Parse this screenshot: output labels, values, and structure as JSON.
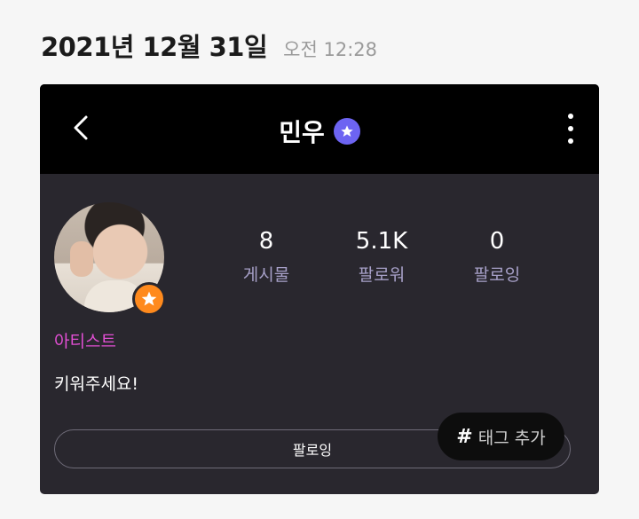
{
  "header": {
    "date": "2021년 12월 31일",
    "time": "오전 12:28"
  },
  "profile": {
    "name": "민우",
    "role": "아티스트",
    "bio": "키워주세요!",
    "stats": [
      {
        "value": "8",
        "label": "게시물"
      },
      {
        "value": "5.1K",
        "label": "팔로워"
      },
      {
        "value": "0",
        "label": "팔로잉"
      }
    ],
    "follow_button": "팔로잉",
    "tag_button": {
      "hash": "#",
      "label": "태그 추가"
    }
  },
  "icons": [
    "back-chevron-icon",
    "verified-star-icon",
    "more-options-icon",
    "artist-star-icon"
  ],
  "colors": {
    "card": "#29272e",
    "topbar": "#000000",
    "verified": "#6d64f2",
    "artist_badge": "#ff8a1d",
    "role": "#e24fd4",
    "stat_label": "#a7a0c8"
  }
}
